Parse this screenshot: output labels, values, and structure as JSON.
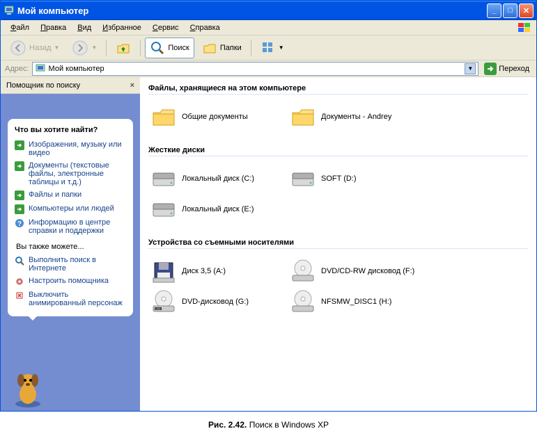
{
  "title": "Мой компьютер",
  "menu": [
    "Файл",
    "Правка",
    "Вид",
    "Избранное",
    "Сервис",
    "Справка"
  ],
  "toolbar": {
    "back": "Назад",
    "search": "Поиск",
    "folders": "Папки"
  },
  "address": {
    "label": "Адрес:",
    "value": "Мой компьютер",
    "go": "Переход"
  },
  "sidebar": {
    "header": "Помощник по поиску",
    "question": "Что вы хотите найти?",
    "opts": [
      "Изображения, музыку или видео",
      "Документы (текстовые файлы, электронные таблицы и т.д.)",
      "Файлы и папки",
      "Компьютеры или людей",
      "Информацию в центре справки и поддержки"
    ],
    "also_label": "Вы также можете...",
    "also": [
      "Выполнить поиск в Интернете",
      "Настроить помощника",
      "Выключить анимированный персонаж"
    ]
  },
  "groups": [
    {
      "title": "Файлы, хранящиеся на этом компьютере",
      "items": [
        {
          "icon": "folder",
          "label": "Общие документы"
        },
        {
          "icon": "folder",
          "label": "Документы - Andrey"
        }
      ]
    },
    {
      "title": "Жесткие диски",
      "items": [
        {
          "icon": "hdd",
          "label": "Локальный диск (C:)"
        },
        {
          "icon": "hdd",
          "label": "SOFT (D:)"
        },
        {
          "icon": "hdd",
          "label": "Локальный диск (E:)"
        }
      ]
    },
    {
      "title": "Устройства со съемными носителями",
      "items": [
        {
          "icon": "floppy",
          "label": "Диск 3,5 (A:)"
        },
        {
          "icon": "cd",
          "label": "DVD/CD-RW дисковод (F:)"
        },
        {
          "icon": "dvd",
          "label": "DVD-дисковод (G:)"
        },
        {
          "icon": "cd",
          "label": "NFSMW_DISC1 (H:)"
        }
      ]
    }
  ],
  "caption_bold": "Рис. 2.42.",
  "caption_text": " Поиск в Windows XP"
}
